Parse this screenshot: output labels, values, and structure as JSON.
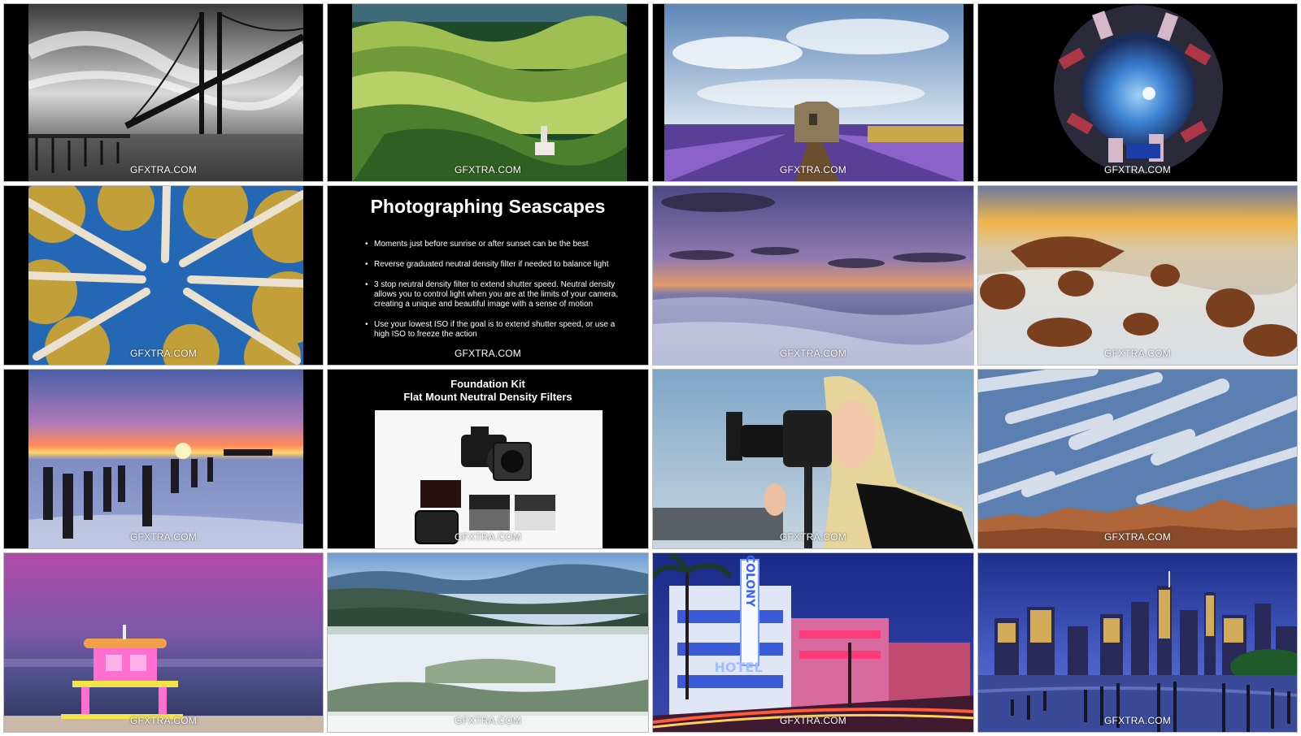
{
  "watermark": "GFXTRA.COM",
  "tiles": [
    {
      "name": "bridge-photo",
      "subject": "black and white suspension bridge long exposure"
    },
    {
      "name": "rolling-hills-photo",
      "subject": "green rolling hills with silo"
    },
    {
      "name": "lavender-field-photo",
      "subject": "lavender field with stone ruin"
    },
    {
      "name": "fisheye-city-photo",
      "subject": "fisheye view of city skyscrapers"
    },
    {
      "name": "aspen-trees-photo",
      "subject": "looking up at aspen trees"
    },
    {
      "name": "seascapes-slide",
      "subject": "text slide"
    },
    {
      "name": "seascape-sunset-photo",
      "subject": "long exposure ocean at dusk"
    },
    {
      "name": "rocky-shore-photo",
      "subject": "rocky shoreline at sunrise"
    },
    {
      "name": "pier-pilings-photo",
      "subject": "pier pilings at sunset"
    },
    {
      "name": "foundation-kit-slide",
      "subject": "camera with ND filters"
    },
    {
      "name": "photographer-photo",
      "subject": "woman photographer with camera and filter holder"
    },
    {
      "name": "streaking-clouds-photo",
      "subject": "streaking clouds over badlands"
    },
    {
      "name": "lifeguard-tower-photo",
      "subject": "pink lifeguard tower at dusk"
    },
    {
      "name": "foggy-valley-photo",
      "subject": "fog over forested valley"
    },
    {
      "name": "colony-hotel-photo",
      "subject": "neon Colony hotel at night"
    },
    {
      "name": "city-skyline-photo",
      "subject": "city skyline over water at night"
    }
  ],
  "seascapes_slide": {
    "title": "Photographing Seascapes",
    "bullets": [
      "Moments just before sunrise or after sunset can be the best",
      "Reverse graduated neutral density filter if needed to balance light",
      "3 stop neutral density filter to extend shutter speed. Neutral density allows you to control light when you are at the limits of your camera, creating a unique and beautiful image with a sense of motion",
      "Use your lowest ISO if the goal is to extend shutter speed, or use a high ISO to freeze the action"
    ]
  },
  "kit_slide": {
    "title_line1": "Foundation Kit",
    "title_line2": "Flat Mount Neutral Density Filters"
  },
  "colony_sign": "COLONY",
  "hotel_sign": "HOTEL"
}
